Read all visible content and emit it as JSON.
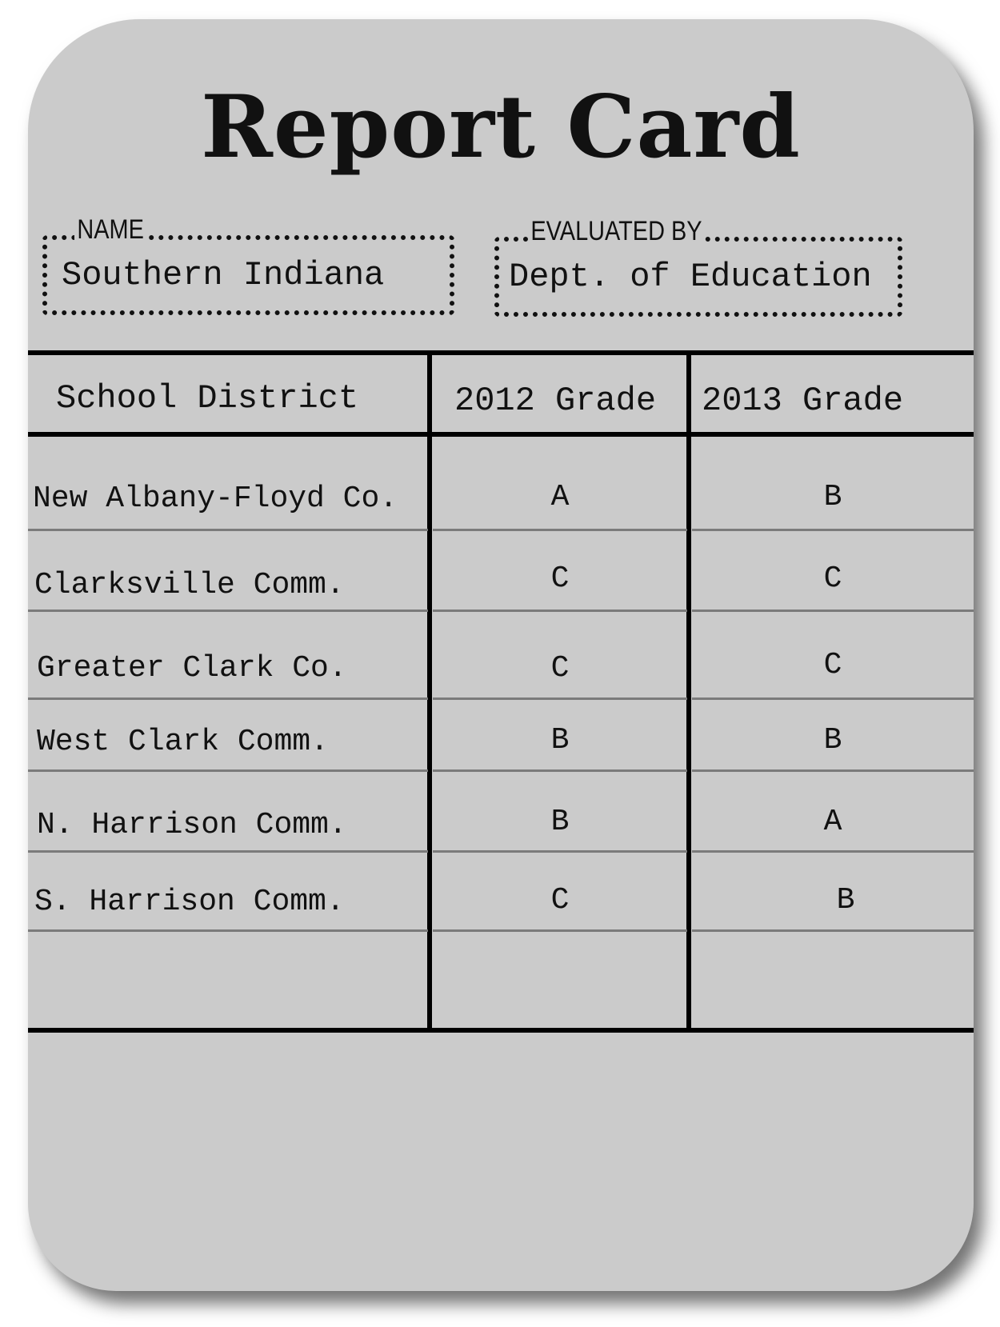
{
  "title": "Report Card",
  "name_field": {
    "label": "NAME",
    "value": "Southern Indiana"
  },
  "evaluated_field": {
    "label": "EVALUATED BY",
    "value": "Dept. of Education"
  },
  "table": {
    "headers": [
      "School District",
      "2012 Grade",
      "2013 Grade"
    ],
    "rows": [
      {
        "district": "New Albany-Floyd Co.",
        "grade_2012": "A",
        "grade_2013": "B"
      },
      {
        "district": "Clarksville Comm.",
        "grade_2012": "C",
        "grade_2013": "C"
      },
      {
        "district": "Greater Clark Co.",
        "grade_2012": "C",
        "grade_2013": "C"
      },
      {
        "district": "West Clark Comm.",
        "grade_2012": "B",
        "grade_2013": "B"
      },
      {
        "district": "N. Harrison Comm.",
        "grade_2012": "B",
        "grade_2013": "A"
      },
      {
        "district": "S. Harrison Comm.",
        "grade_2012": "C",
        "grade_2013": "B"
      }
    ]
  }
}
